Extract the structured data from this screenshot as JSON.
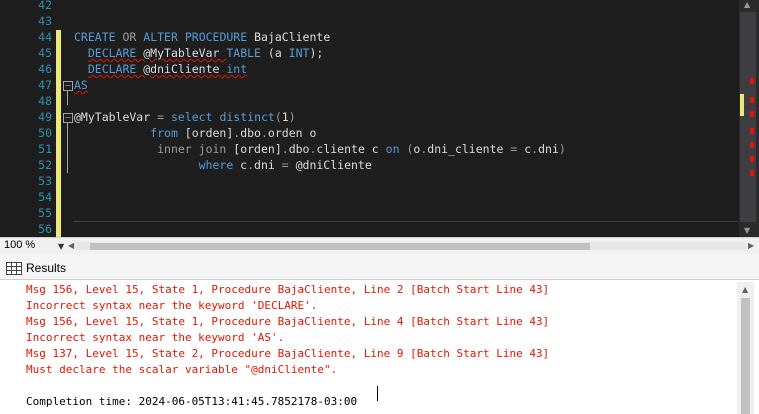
{
  "editor": {
    "line_numbers": [
      "42",
      "43",
      "44",
      "45",
      "46",
      "47",
      "48",
      "49",
      "50",
      "51",
      "52",
      "53",
      "54",
      "55",
      "56"
    ],
    "lines": [
      {
        "id": "l44",
        "parts": [
          [
            "kw",
            "CREATE"
          ],
          [
            "txt",
            " "
          ],
          [
            "gr",
            "OR"
          ],
          [
            "txt",
            " "
          ],
          [
            "kw",
            "ALTER"
          ],
          [
            "txt",
            " "
          ],
          [
            "kw",
            "PROCEDURE"
          ],
          [
            "txt",
            " BajaCliente"
          ]
        ]
      },
      {
        "id": "l45",
        "parts": [
          [
            "txt",
            "  "
          ],
          [
            "kw",
            "DECLARE"
          ],
          [
            "txt",
            " @MyTableVar "
          ],
          [
            "kw",
            "TABLE"
          ],
          [
            "txt",
            " (a "
          ],
          [
            "kw",
            "INT"
          ],
          [
            "txt",
            ");"
          ]
        ]
      },
      {
        "id": "l46",
        "parts": [
          [
            "txt",
            "  "
          ],
          [
            "kw",
            "DECLARE"
          ],
          [
            "txt",
            " @dniCliente "
          ],
          [
            "kw",
            "int"
          ]
        ]
      },
      {
        "id": "l47",
        "parts": [
          [
            "kw",
            "AS"
          ]
        ]
      },
      {
        "id": "l49",
        "parts": [
          [
            "txt",
            "@MyTableVar "
          ],
          [
            "gr",
            "="
          ],
          [
            "txt",
            " "
          ],
          [
            "kw",
            "select"
          ],
          [
            "txt",
            " "
          ],
          [
            "kw",
            "distinct"
          ],
          [
            "gr",
            "("
          ],
          [
            "txt",
            "1"
          ],
          [
            "gr",
            ")"
          ]
        ]
      },
      {
        "id": "l50",
        "parts": [
          [
            "txt",
            "           "
          ],
          [
            "kw",
            "from"
          ],
          [
            "txt",
            " [orden]"
          ],
          [
            "gr",
            "."
          ],
          [
            "txt",
            "dbo"
          ],
          [
            "gr",
            "."
          ],
          [
            "txt",
            "orden o"
          ]
        ]
      },
      {
        "id": "l51",
        "parts": [
          [
            "txt",
            "            "
          ],
          [
            "gr",
            "inner"
          ],
          [
            "txt",
            " "
          ],
          [
            "gr",
            "join"
          ],
          [
            "txt",
            " [orden]"
          ],
          [
            "gr",
            "."
          ],
          [
            "txt",
            "dbo"
          ],
          [
            "gr",
            "."
          ],
          [
            "txt",
            "cliente c "
          ],
          [
            "kw",
            "on"
          ],
          [
            "txt",
            " "
          ],
          [
            "gr",
            "("
          ],
          [
            "txt",
            "o"
          ],
          [
            "gr",
            "."
          ],
          [
            "txt",
            "dni_cliente "
          ],
          [
            "gr",
            "="
          ],
          [
            "txt",
            " c"
          ],
          [
            "gr",
            "."
          ],
          [
            "txt",
            "dni"
          ],
          [
            "gr",
            ")"
          ]
        ]
      },
      {
        "id": "l52",
        "parts": [
          [
            "txt",
            "                  "
          ],
          [
            "kw",
            "where"
          ],
          [
            "txt",
            " c"
          ],
          [
            "gr",
            "."
          ],
          [
            "txt",
            "dni "
          ],
          [
            "gr",
            "="
          ],
          [
            "txt",
            " @dniCliente"
          ]
        ]
      }
    ]
  },
  "zoom": {
    "value": "100 %"
  },
  "results_tab": {
    "label": "Results"
  },
  "messages": [
    {
      "type": "err",
      "text": "Msg 156, Level 15, State 1, Procedure BajaCliente, Line 2 [Batch Start Line 43]"
    },
    {
      "type": "err",
      "text": "Incorrect syntax near the keyword 'DECLARE'."
    },
    {
      "type": "err",
      "text": "Msg 156, Level 15, State 1, Procedure BajaCliente, Line 4 [Batch Start Line 43]"
    },
    {
      "type": "err",
      "text": "Incorrect syntax near the keyword 'AS'."
    },
    {
      "type": "err",
      "text": "Msg 137, Level 15, State 2, Procedure BajaCliente, Line 9 [Batch Start Line 43]"
    },
    {
      "type": "err",
      "text": "Must declare the scalar variable \"@dniCliente\"."
    },
    {
      "type": "blank",
      "text": ""
    },
    {
      "type": "norm",
      "text": "Completion time: 2024-06-05T13:41:45.7852178-03:00"
    }
  ],
  "colors": {
    "keyword": "#569cd6",
    "line_number": "#2b91af",
    "error": "#e51400",
    "change_marker": "#ebe97a"
  }
}
